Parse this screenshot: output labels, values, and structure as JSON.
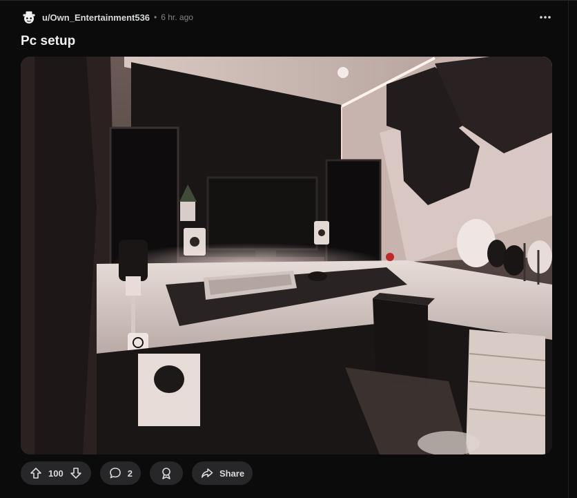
{
  "post": {
    "username": "u/Own_Entertainment536",
    "separator": "•",
    "time": "6 hr. ago",
    "title": "Pc setup"
  },
  "actions": {
    "score": "100",
    "comments": "2",
    "share_label": "Share"
  },
  "icons": {
    "avatar": "snoo-avatar-icon",
    "more": "more-horizontal-icon",
    "upvote": "upvote-arrow-icon",
    "downvote": "downvote-arrow-icon",
    "comment": "comment-bubble-icon",
    "award": "award-icon",
    "share": "share-arrow-icon"
  },
  "colors": {
    "background": "#0b0b0b",
    "pill": "#272729",
    "text": "#d7dadc",
    "muted": "#818384"
  }
}
